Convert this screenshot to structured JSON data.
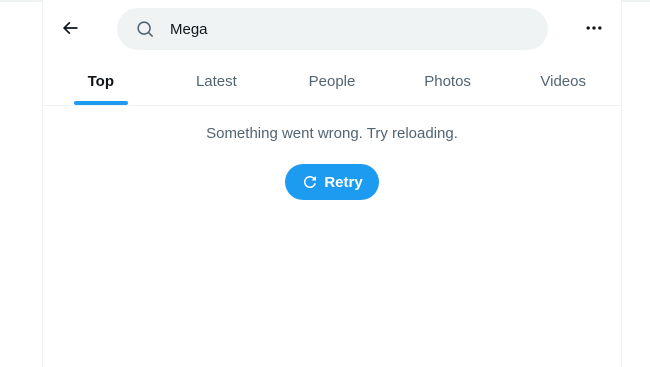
{
  "search": {
    "value": "Mega",
    "back_icon": "arrow-left-icon",
    "search_icon": "search-icon",
    "more_icon": "more-horizontal-icon"
  },
  "tabs": [
    {
      "label": "Top",
      "active": true
    },
    {
      "label": "Latest",
      "active": false
    },
    {
      "label": "People",
      "active": false
    },
    {
      "label": "Photos",
      "active": false
    },
    {
      "label": "Videos",
      "active": false
    }
  ],
  "error": {
    "message": "Something went wrong. Try reloading.",
    "retry_label": "Retry",
    "retry_icon": "refresh-icon"
  },
  "colors": {
    "accent": "#1d9bf0",
    "text_primary": "#0f1419",
    "text_secondary": "#536471",
    "search_bg": "#eff3f4"
  }
}
